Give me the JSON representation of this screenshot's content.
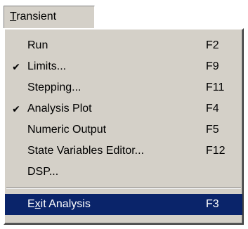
{
  "menu": {
    "title_mnemonic": "T",
    "title_rest": "ransient",
    "items": [
      {
        "label": "Run",
        "shortcut": "F2",
        "checked": ""
      },
      {
        "label": "Limits...",
        "shortcut": "F9",
        "checked": "✔"
      },
      {
        "label": "Stepping...",
        "shortcut": "F11",
        "checked": ""
      },
      {
        "label": "Analysis Plot",
        "shortcut": "F4",
        "checked": "✔"
      },
      {
        "label": "Numeric Output",
        "shortcut": "F5",
        "checked": ""
      },
      {
        "label": "State Variables Editor...",
        "shortcut": "F12",
        "checked": ""
      },
      {
        "label": "DSP...",
        "shortcut": "",
        "checked": ""
      }
    ],
    "exit_item": {
      "label_pre": "E",
      "label_mnemonic": "x",
      "label_post": "it Analysis",
      "shortcut": "F3"
    }
  },
  "colors": {
    "menu_face": "#d4d0c8",
    "highlight": "#0a246a",
    "highlight_text": "#ffffff"
  }
}
